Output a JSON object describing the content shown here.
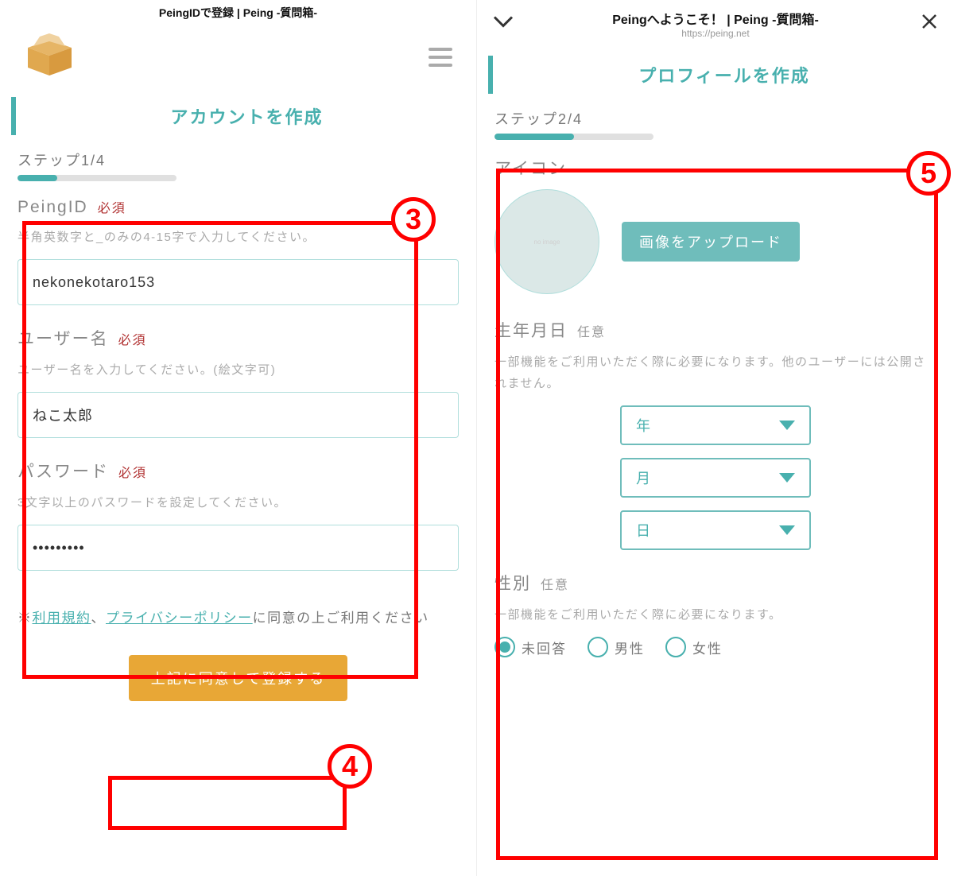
{
  "left": {
    "topbar_title": "PeingIDで登録 | Peing -質問箱-",
    "heading": "アカウントを作成",
    "step_label": "ステップ1/4",
    "fields": {
      "peing_id": {
        "label": "PeingID",
        "tag": "必須",
        "help": "半角英数字と_のみの4-15字で入力してください。",
        "value": "nekonekotaro153"
      },
      "username": {
        "label": "ユーザー名",
        "tag": "必須",
        "help": "ユーザー名を入力してください。(絵文字可)",
        "value": "ねこ太郎"
      },
      "password": {
        "label": "パスワード",
        "tag": "必須",
        "help": "3文字以上のパスワードを設定してください。",
        "value": "•••••••••"
      }
    },
    "agree_prefix": "※",
    "agree_link1": "利用規約",
    "agree_sep": "、",
    "agree_link2": "プライバシーポリシー",
    "agree_suffix": "に同意の上ご利用ください",
    "submit_label": "上記に同意して登録する"
  },
  "right": {
    "topbar_title": "Peingへようこそ！ | Peing -質問箱-",
    "topbar_url": "https://peing.net",
    "heading": "プロフィールを作成",
    "step_label": "ステップ2/4",
    "icon_section": {
      "label": "アイコン",
      "upload_label": "画像をアップロード"
    },
    "birth_section": {
      "label": "生年月日",
      "tag": "任意",
      "help": "一部機能をご利用いただく際に必要になります。他のユーザーには公開されません。",
      "selects": {
        "year": "年",
        "month": "月",
        "day": "日"
      }
    },
    "gender_section": {
      "label": "性別",
      "tag": "任意",
      "help": "一部機能をご利用いただく際に必要になります。",
      "options": {
        "unanswered": "未回答",
        "male": "男性",
        "female": "女性"
      },
      "selected": "unanswered"
    }
  },
  "callouts": {
    "c3": "3",
    "c4": "4",
    "c5": "5"
  }
}
